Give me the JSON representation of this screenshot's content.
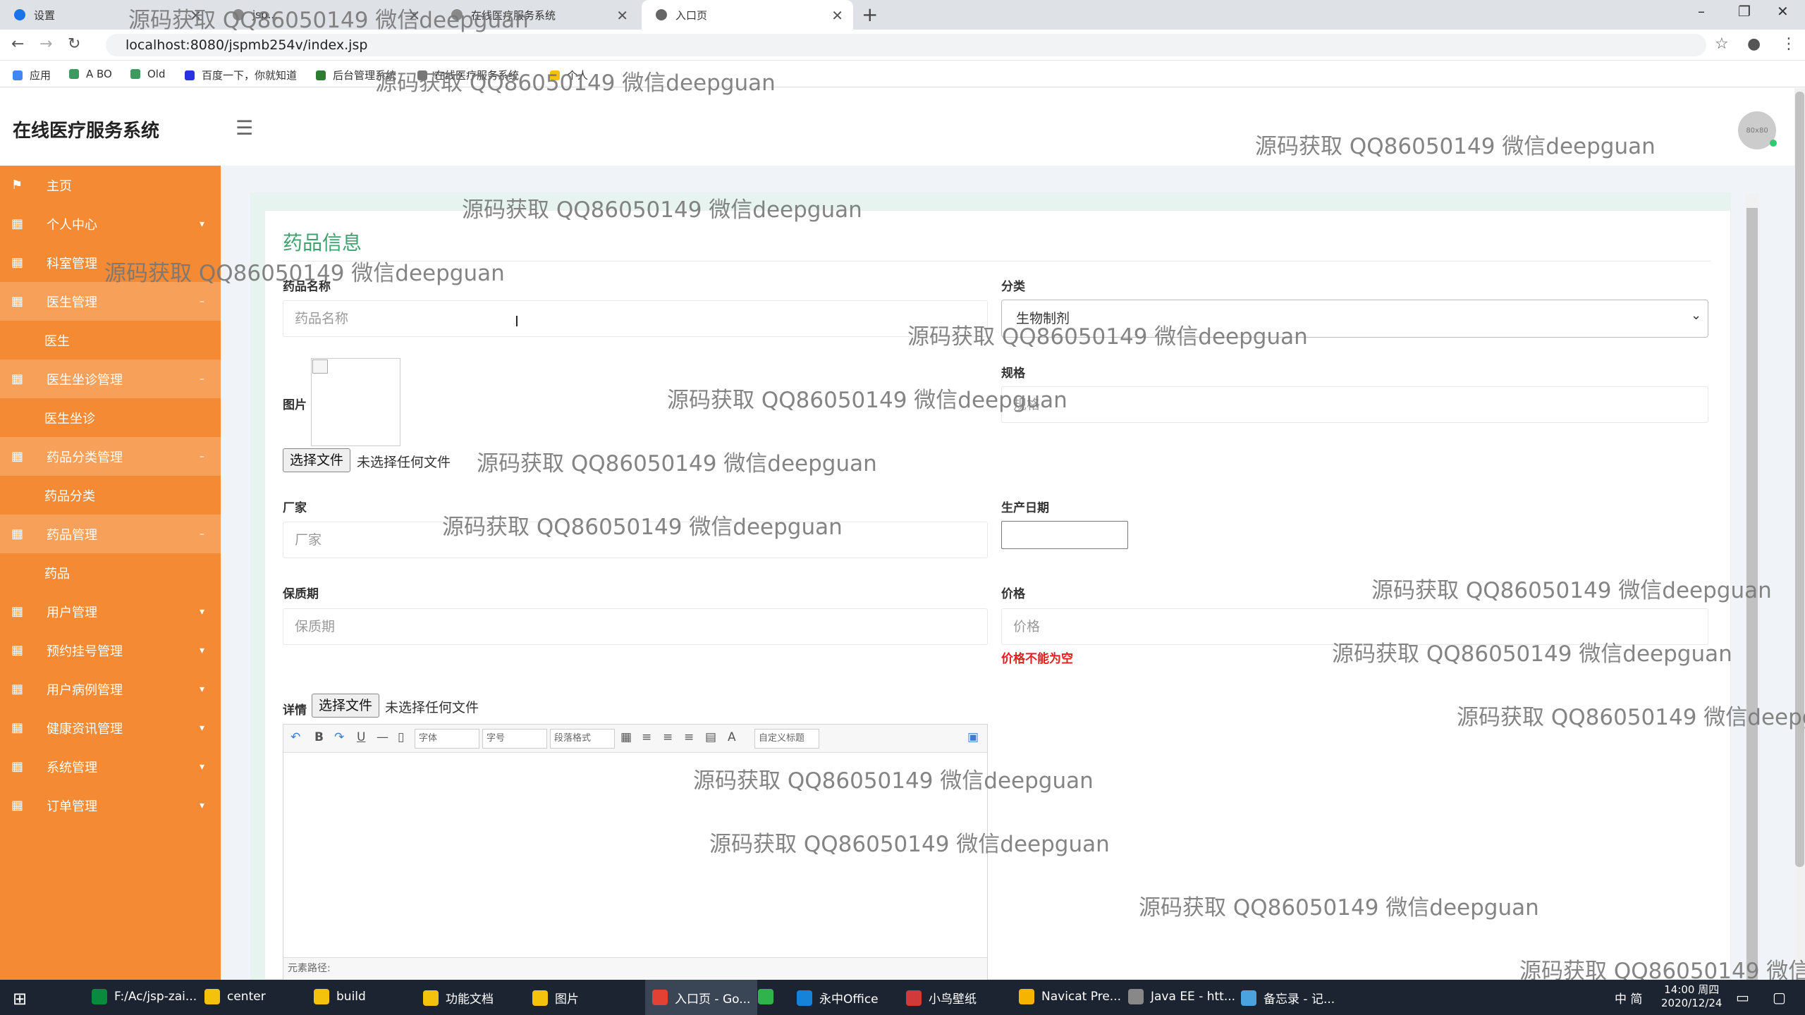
{
  "browser": {
    "tabs": [
      {
        "label": "设置"
      },
      {
        "label": "jsp..."
      },
      {
        "label": "在线医疗服务系统"
      },
      {
        "label": "入口页"
      }
    ],
    "url": "localhost:8080/jspmb254v/index.jsp",
    "bookmarks": [
      "应用",
      "A BO",
      "Old",
      "百度一下，你就知道",
      "后台管理系统",
      "在线医疗服务系统",
      "个人"
    ]
  },
  "app": {
    "brand": "在线医疗服务系统",
    "avatar_text": "80x80"
  },
  "sidebar": {
    "items": [
      {
        "label": "主页",
        "type": "parent"
      },
      {
        "label": "个人中心",
        "type": "parent"
      },
      {
        "label": "科室管理",
        "type": "parent"
      },
      {
        "label": "医生管理",
        "type": "open"
      },
      {
        "label": "医生",
        "type": "child"
      },
      {
        "label": "医生坐诊管理",
        "type": "open"
      },
      {
        "label": "医生坐诊",
        "type": "child"
      },
      {
        "label": "药品分类管理",
        "type": "open"
      },
      {
        "label": "药品分类",
        "type": "child"
      },
      {
        "label": "药品管理",
        "type": "open"
      },
      {
        "label": "药品",
        "type": "child"
      },
      {
        "label": "用户管理",
        "type": "parent"
      },
      {
        "label": "预约挂号管理",
        "type": "parent"
      },
      {
        "label": "用户病例管理",
        "type": "parent"
      },
      {
        "label": "健康资讯管理",
        "type": "parent"
      },
      {
        "label": "系统管理",
        "type": "parent"
      },
      {
        "label": "订单管理",
        "type": "parent"
      }
    ]
  },
  "form": {
    "title": "药品信息",
    "name_label": "药品名称",
    "name_placeholder": "药品名称",
    "category_label": "分类",
    "category_value": "生物制剂",
    "image_label": "图片",
    "spec_label": "规格",
    "spec_placeholder": "规格",
    "file_button": "选择文件",
    "file_none": "未选择任何文件",
    "maker_label": "厂家",
    "maker_placeholder": "厂家",
    "date_label": "生产日期",
    "shelf_label": "保质期",
    "shelf_placeholder": "保质期",
    "price_label": "价格",
    "price_placeholder": "价格",
    "price_error": "价格不能为空",
    "detail_label": "详情",
    "editor": {
      "font": "字体",
      "size": "字号",
      "para": "段落格式",
      "custom": "自定义标题",
      "path": "元素路径:"
    }
  },
  "watermark": "源码获取 QQ86050149 微信deepguan",
  "taskbar": {
    "items": [
      "F:/Ac/jsp-zai...",
      "center",
      "build",
      "功能文档",
      "图片",
      "入口页 - Go...",
      "",
      "永中Office",
      "小鸟壁纸",
      "Navicat Pre...",
      "Java EE - htt...",
      "备忘录 - 记..."
    ],
    "ime": "中 简",
    "time": "14:00 周四",
    "date": "2020/12/24"
  }
}
